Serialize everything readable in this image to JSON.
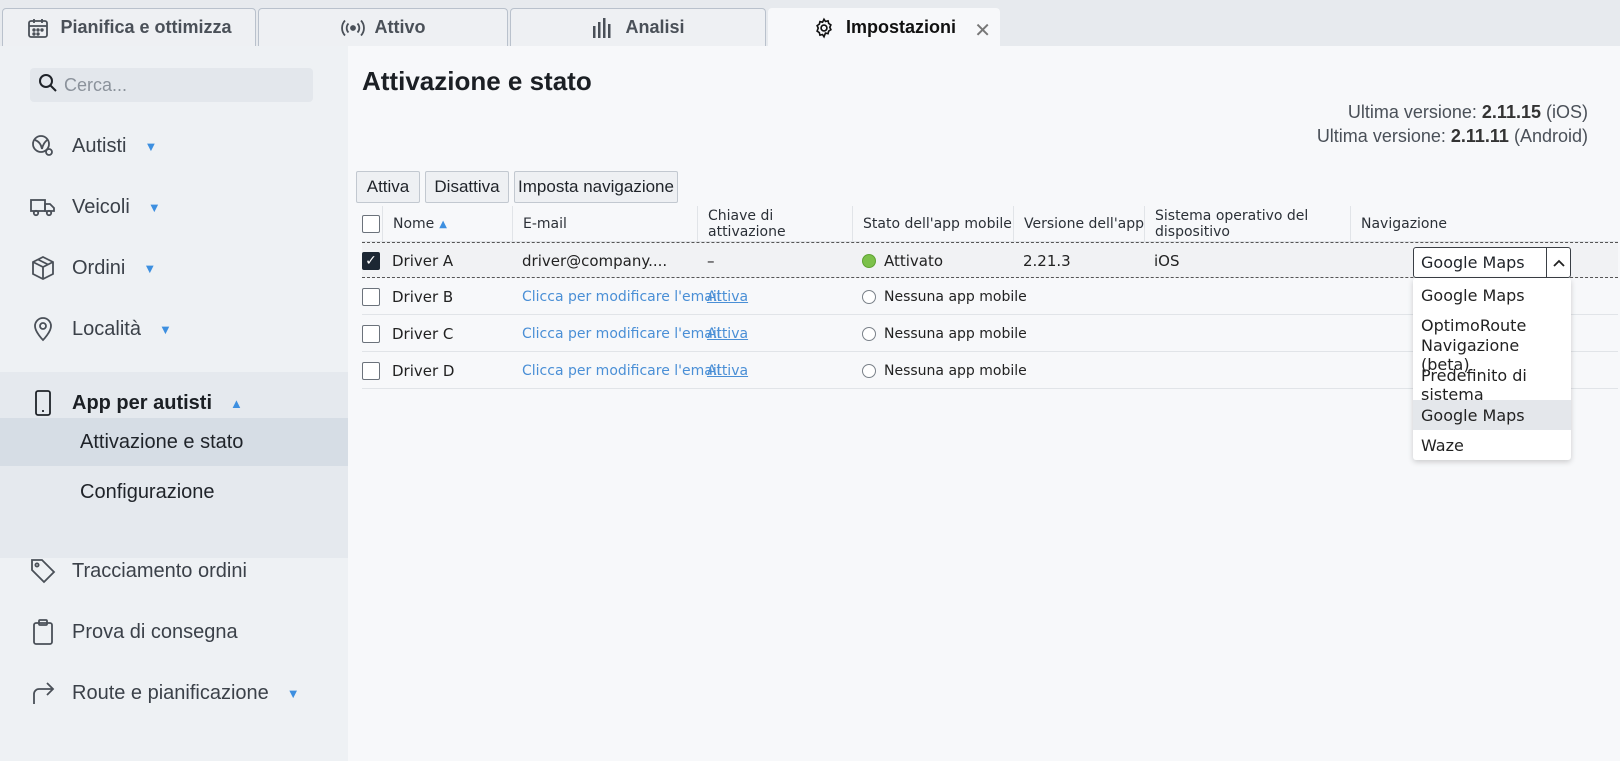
{
  "tabs": [
    {
      "label": "Pianifica e ottimizza",
      "icon": "calendar-icon"
    },
    {
      "label": "Attivo",
      "icon": "broadcast-icon"
    },
    {
      "label": "Analisi",
      "icon": "bar-chart-icon"
    },
    {
      "label": "Impostazioni",
      "icon": "gear-icon",
      "active": true
    }
  ],
  "sidebar": {
    "search_placeholder": "Cerca...",
    "items": [
      {
        "label": "Autisti",
        "icon": "driver-icon"
      },
      {
        "label": "Veicoli",
        "icon": "truck-icon"
      },
      {
        "label": "Ordini",
        "icon": "box-icon"
      },
      {
        "label": "Località",
        "icon": "location-pin-icon"
      },
      {
        "label": "App per autisti",
        "icon": "phone-icon"
      },
      {
        "label": "Tracciamento ordini",
        "icon": "tag-icon"
      },
      {
        "label": "Prova di consegna",
        "icon": "clipboard-icon"
      },
      {
        "label": "Route e pianificazione",
        "icon": "route-arrow-icon"
      }
    ],
    "subitems": [
      {
        "label": "Attivazione e stato"
      },
      {
        "label": "Configurazione"
      }
    ]
  },
  "main": {
    "title": "Attivazione e stato",
    "versions": [
      {
        "prefix": "Ultima versione:",
        "number": "2.11.15",
        "platform": "(iOS)"
      },
      {
        "prefix": "Ultima versione:",
        "number": "2.11.11",
        "platform": "(Android)"
      }
    ],
    "buttons": {
      "activate": "Attiva",
      "deactivate": "Disattiva",
      "set_nav": "Imposta navigazione"
    },
    "table": {
      "headers": [
        "Nome",
        "E-mail",
        "Chiave di attivazione",
        "Stato dell'app mobile",
        "Versione dell'app",
        "Sistema operativo del dispositivo",
        "Navigazione"
      ],
      "rows": [
        {
          "name": "Driver A",
          "email": "driver@company....",
          "key": "–",
          "status": "Attivato",
          "version": "2.21.3",
          "os": "iOS",
          "nav": "Google Maps"
        },
        {
          "name": "Driver B",
          "email": "Clicca per modificare l'email",
          "key": "Attiva",
          "status": "Nessuna app mobile"
        },
        {
          "name": "Driver C",
          "email": "Clicca per modificare l'email",
          "key": "Attiva",
          "status": "Nessuna app mobile"
        },
        {
          "name": "Driver D",
          "email": "Clicca per modificare l'email",
          "key": "Attiva",
          "status": "Nessuna app mobile"
        }
      ]
    },
    "nav_options": [
      "Google Maps",
      "OptimoRoute",
      "Navigazione (beta)",
      "Predefinito di sistema",
      "Google Maps",
      "Waze"
    ]
  },
  "colors": {
    "accent": "#3d8fe0",
    "link": "#4a8fd6",
    "active_dot": "#7cc14a"
  }
}
